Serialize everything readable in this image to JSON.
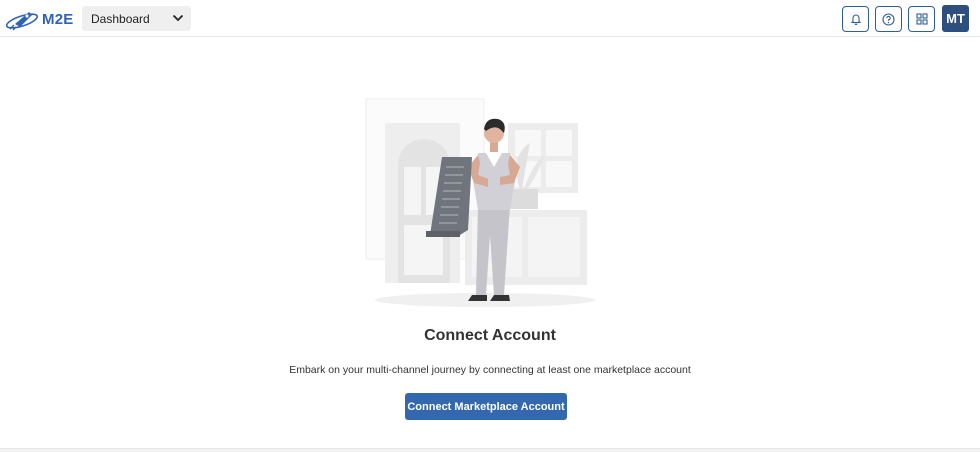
{
  "header": {
    "logo_text": "M2E",
    "view_select": {
      "selected": "Dashboard"
    },
    "icons": [
      "bell-icon",
      "help-icon",
      "apps-grid-icon"
    ],
    "avatar_initials": "MT",
    "colors": {
      "brand": "#2f63b5",
      "avatar_bg": "#2e4e7e",
      "button_border": "#2f5d96"
    }
  },
  "empty_state": {
    "title": "Connect Account",
    "description": "Embark on your multi-channel journey by connecting at least one marketplace account",
    "cta_label": "Connect Marketplace Account",
    "cta_color": "#3468ae"
  }
}
